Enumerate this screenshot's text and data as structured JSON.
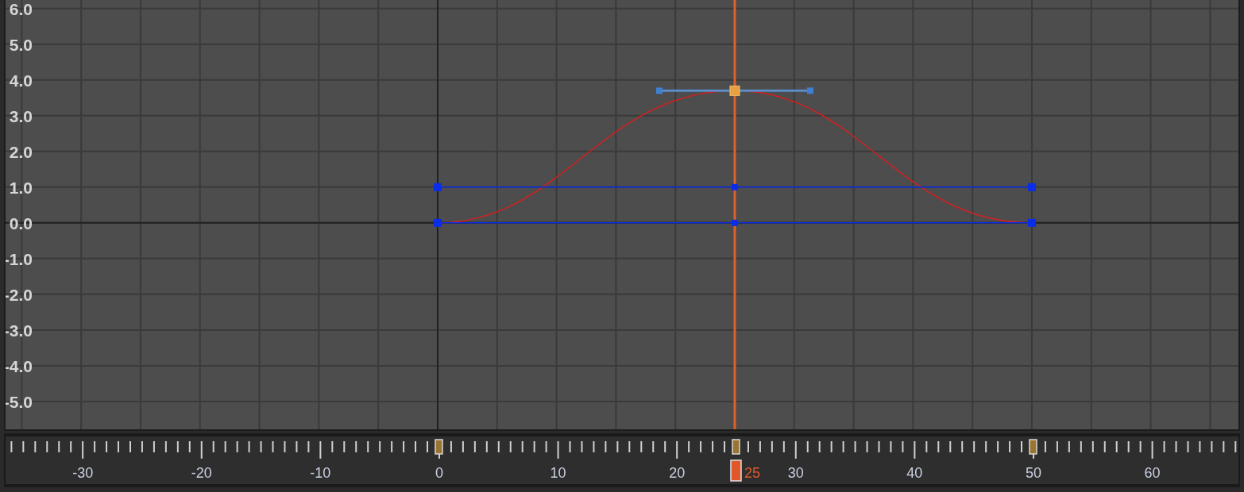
{
  "graph": {
    "chart_data": {
      "type": "line",
      "grid": true,
      "x": [
        0,
        25,
        50
      ],
      "series": [
        {
          "color": "#d42020",
          "values": [
            0,
            3.7,
            0
          ]
        },
        {
          "color": "#0a2ee8",
          "marker": "square",
          "values": [
            1,
            1,
            1
          ]
        },
        {
          "color": "#0a2ee8",
          "marker": "square",
          "values": [
            0,
            0,
            0
          ]
        }
      ],
      "xlim": [
        -36.36,
        67.38
      ],
      "ylim": [
        -5.78,
        6.24
      ],
      "xticks": [
        -30,
        -20,
        -10,
        0,
        10,
        20,
        30,
        40,
        50,
        60
      ],
      "yticks": [
        {
          "value": 6,
          "label": "6.0"
        },
        {
          "value": 5,
          "label": "5.0"
        },
        {
          "value": 4,
          "label": "4.0"
        },
        {
          "value": 3,
          "label": "3.0"
        },
        {
          "value": 2,
          "label": "2.0"
        },
        {
          "value": 1,
          "label": "1.0"
        },
        {
          "value": 0,
          "label": "0.0"
        },
        {
          "value": -1,
          "label": "-1.0"
        },
        {
          "value": -2,
          "label": "-2.0"
        },
        {
          "value": -3,
          "label": "-3.0"
        },
        {
          "value": -4,
          "label": "-4.0"
        },
        {
          "value": -5,
          "label": "-5.0"
        }
      ],
      "ref_lines": [
        {
          "axis": "x",
          "value": 25,
          "color": "#e0602a"
        }
      ],
      "annotations": [
        "25"
      ]
    }
  }
}
